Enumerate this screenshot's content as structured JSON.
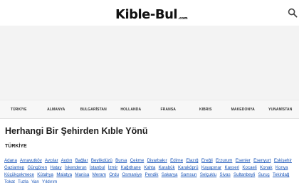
{
  "header": {
    "logo_main": "Kible-Bul",
    "logo_tld": ".com",
    "search_icon": "search-icon"
  },
  "countries": [
    {
      "label": "TÜRKİYE"
    },
    {
      "label": "ALMANYA"
    },
    {
      "label": "BULGARİSTAN"
    },
    {
      "label": "HOLLANDA"
    },
    {
      "label": "FRANSA"
    },
    {
      "label": "KIBRIS"
    },
    {
      "label": "MAKEDONYA"
    },
    {
      "label": "YUNANİSTAN"
    }
  ],
  "main": {
    "title": "Herhangi Bir Şehirden Kıble Yönü",
    "section_title": "TÜRKİYE",
    "cities": [
      "Adana",
      "Arnavutköy",
      "Avcılar",
      "Aydın",
      "Bağlar",
      "Beylikdüzü",
      "Bursa",
      "Çekme",
      "Diyarbakır",
      "Edirne",
      "Elazığ",
      "Ereğli",
      "Erzurum",
      "Esenler",
      "Esenyurt",
      "Eskişehir",
      "Gaziantep",
      "Güngören",
      "Hatay",
      "İskenderun",
      "İstanbul",
      "İzmir",
      "Kağıthane",
      "Kahta",
      "Karabük",
      "Karaköprü",
      "Kayapınar",
      "Kayseri",
      "Kocaeli",
      "Konak",
      "Konya",
      "Küçükçekmece",
      "Kütahya",
      "Malatya",
      "Manisa",
      "Meram",
      "Ordu",
      "Osmaniye",
      "Pendik",
      "Sakarya",
      "Samsun",
      "Selçuklu",
      "Sivas",
      "Sultanbeyli",
      "Suruç",
      "Tekirdağ",
      "Tokat",
      "Tuzla",
      "Van",
      "Yıldırım"
    ]
  },
  "colors": {
    "link": "#1a55b8",
    "nav_bg": "#f7f7f7",
    "ad_bg": "#f3f3f3"
  }
}
